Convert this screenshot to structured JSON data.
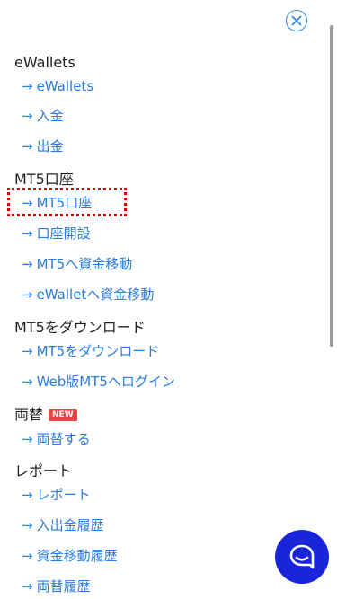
{
  "sections": [
    {
      "title": "eWallets",
      "items": [
        "eWallets",
        "入金",
        "出金"
      ]
    },
    {
      "title": "MT5口座",
      "items": [
        "MT5口座",
        "口座開設",
        "MT5へ資金移動",
        "eWalletへ資金移動"
      ]
    },
    {
      "title": "MT5をダウンロード",
      "items": [
        "MT5をダウンロード",
        "Web版MT5へログイン"
      ]
    },
    {
      "title": "両替",
      "badge": "NEW",
      "items": [
        "両替する"
      ]
    },
    {
      "title": "レポート",
      "items": [
        "レポート",
        "入出金履歴",
        "資金移動履歴",
        "両替履歴"
      ]
    }
  ],
  "arrow": "→",
  "colors": {
    "accent": "#2a7be0",
    "badge": "#e84545",
    "chat": "#1a24d8",
    "highlight": "#e00000"
  },
  "icons": {
    "close": "close-circle-icon",
    "chat": "chat-bubble-icon"
  }
}
